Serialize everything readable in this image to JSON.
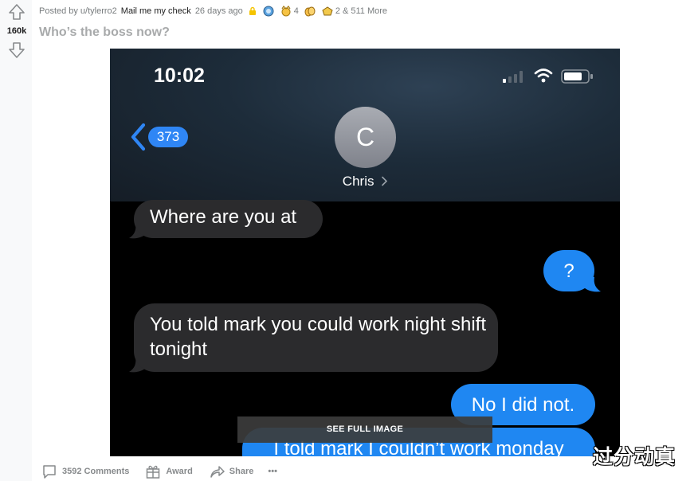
{
  "vote": {
    "score": "160k"
  },
  "post": {
    "posted_by_prefix": "Posted by",
    "author": "u/tylerro2",
    "flair": "Mail me my check",
    "time": "26 days ago",
    "award_count_1": "4",
    "award_count_2": "2",
    "more_awards": "& 511 More",
    "title": "Who’s the boss now?"
  },
  "screenshot": {
    "clock": "10:02",
    "back_count": "373",
    "contact_initial": "C",
    "contact_name": "Chris",
    "messages": [
      {
        "side": "received",
        "text": "Where are you at"
      },
      {
        "side": "sent",
        "text": "?"
      },
      {
        "side": "received",
        "text": "You told mark you could work night shift tonight"
      },
      {
        "side": "sent",
        "text": "No I did not."
      },
      {
        "side": "sent",
        "text": "I told mark I couldn’t work monday"
      }
    ],
    "see_full_label": "SEE FULL IMAGE"
  },
  "actions": {
    "comments": "3592 Comments",
    "award": "Award",
    "share": "Share",
    "more": "•••"
  },
  "watermark": "过分动真",
  "colors": {
    "imessage_blue": "#1f87f2",
    "received_gray": "#2b2b2d",
    "meta_gray": "#787c7e"
  }
}
